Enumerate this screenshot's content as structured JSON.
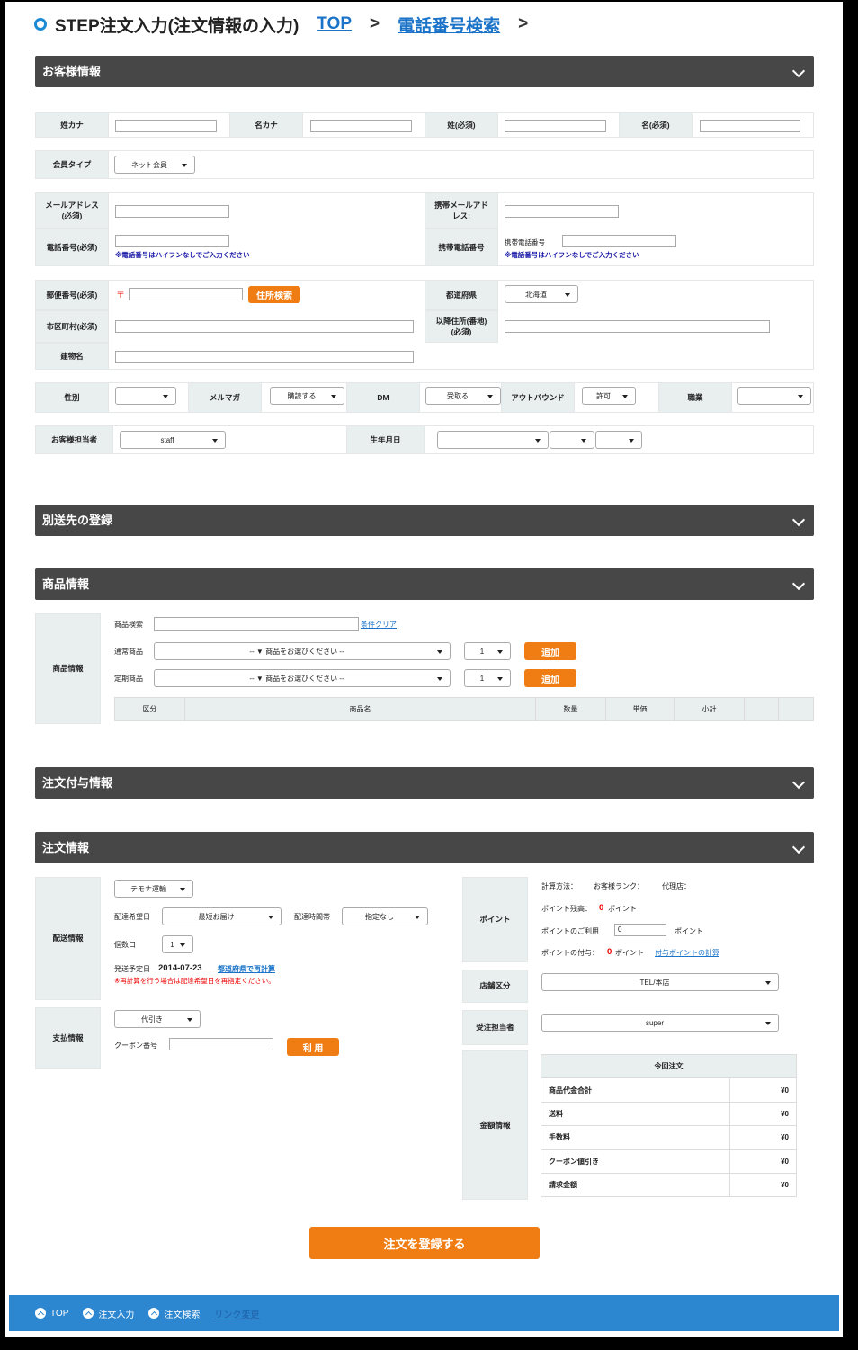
{
  "header": {
    "title": "STEP注文入力(注文情報の入力)",
    "link_top": "TOP",
    "sep": ">",
    "link_phone": "電話番号検索",
    "sep2": ">"
  },
  "sections": {
    "customer": "お客様情報",
    "shipping": "別送先の登録",
    "product": "商品情報",
    "order_extra": "注文付与情報",
    "order": "注文情報"
  },
  "customer": {
    "sei_kana": "姓カナ",
    "mei_kana": "名カナ",
    "sei": "姓(必須)",
    "mei": "名(必須)",
    "member_type": "会員タイプ",
    "member_type_value": "ネット会員",
    "email_l1": "メールアドレス",
    "email_l2": "(必須)",
    "mobile_email_l1": "携帯メールアド",
    "mobile_email_l2": "レス:",
    "phone": "電話番号(必須)",
    "phone_note": "※電話番号はハイフンなしでご入力ください",
    "mobile_phone": "携帯電話番号",
    "mobile_phone_inner": "携帯電話番号",
    "mobile_note": "※電話番号はハイフンなしでご入力ください",
    "zip": "郵便番号(必須)",
    "zip_mark": "〒",
    "zip_search": "住所検索",
    "pref": "都道府県",
    "pref_value": "北海道",
    "city": "市区町村(必須)",
    "address_l1": "以降住所(番地)",
    "address_l2": "(必須)",
    "building": "建物名",
    "gender": "性別",
    "gender_value": "",
    "mailmag": "メルマガ",
    "mailmag_value": "購読する",
    "dm": "DM",
    "dm_value": "受取る",
    "outbound": "アウトバウンド",
    "outbound_value": "許可",
    "job": "職業",
    "job_value": "",
    "staff": "お客様担当者",
    "staff_value": "staff",
    "birthday": "生年月日"
  },
  "product": {
    "label": "商品情報",
    "search": "商品検索",
    "clear": "条件クリア",
    "normal": "通常商品",
    "regular": "定期商品",
    "select_placeholder": "-- ▼ 商品をお選びください --",
    "qty": "1",
    "add": "追加",
    "cols": [
      "区分",
      "商品名",
      "数量",
      "単価",
      "小計",
      "",
      ""
    ]
  },
  "order": {
    "delivery_label": "配送情報",
    "carrier": "テモナ運輸",
    "date_label": "配達希望日",
    "date_value": "最短お届け",
    "time_label": "配達時間帯",
    "time_value": "指定なし",
    "count_label": "個数口",
    "count_value": "1",
    "ship_label": "発送予定日",
    "ship_date": "2014-07-23",
    "recalc": "都道府県で再計算",
    "recalc_note": "※再計算を行う場合は配達希望日を再指定ください。",
    "payment_label": "支払情報",
    "payment_value": "代引き",
    "coupon_label": "クーポン番号",
    "coupon_btn": "利 用",
    "point_label": "ポイント",
    "calc_method": "計算方法：",
    "rank": "お客様ランク：",
    "agent": "代理店：",
    "point_balance": "ポイント残高：",
    "point_balance_value": "0",
    "point_unit": "ポイント",
    "point_use": "ポイントのご利用",
    "point_use_value": "0",
    "point_use_unit": "ポイント",
    "point_grant": "ポイントの付与：",
    "point_grant_value": "0",
    "point_grant_unit": "ポイント",
    "point_calc": "付与ポイントの計算",
    "store_label": "店舗区分",
    "store_value": "TEL/本店",
    "staff_label": "受注担当者",
    "staff_value": "super",
    "amount_label": "金額情報",
    "amount_header": "今回注文",
    "amounts": [
      {
        "label": "商品代金合計",
        "value": "¥0"
      },
      {
        "label": "送料",
        "value": "¥0"
      },
      {
        "label": "手数料",
        "value": "¥0"
      },
      {
        "label": "クーポン値引き",
        "value": "¥0"
      },
      {
        "label": "請求金額",
        "value": "¥0"
      }
    ]
  },
  "submit": "注文を登録する",
  "footer": {
    "top": "TOP",
    "order_input": "注文入力",
    "order_search": "注文検索",
    "link_change": "リンク変更"
  },
  "colors": {
    "accent": "#f07d14",
    "bar": "#474747",
    "footer": "#2c86d0",
    "link": "#1a73c8"
  }
}
